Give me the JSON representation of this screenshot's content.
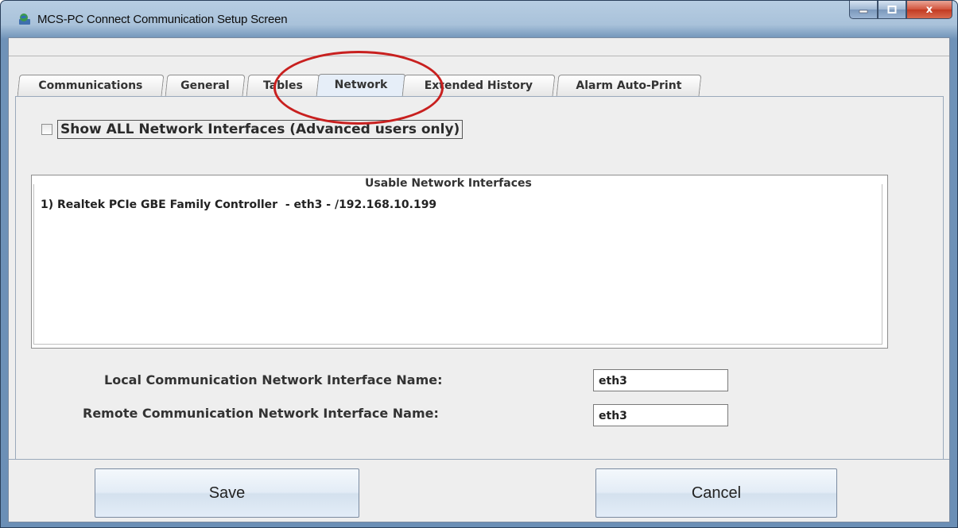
{
  "window": {
    "title": "MCS-PC Connect Communication Setup Screen",
    "app_icon": "globe-monitor-icon",
    "controls": {
      "minimize_icon": "minimize-icon",
      "maximize_icon": "maximize-icon",
      "close_icon": "close-icon",
      "close_glyph": "x"
    }
  },
  "tabs": [
    {
      "label": "Communications"
    },
    {
      "label": "General"
    },
    {
      "label": "Tables"
    },
    {
      "label": "Network",
      "active": true
    },
    {
      "label": "Extended History"
    },
    {
      "label": "Alarm Auto-Print"
    }
  ],
  "network": {
    "show_all_label": "Show ALL Network Interfaces (Advanced users only)",
    "show_all_checked": false,
    "usable_title": "Usable Network Interfaces",
    "interfaces": [
      "1) Realtek PCIe GBE Family Controller  - eth3 - /192.168.10.199"
    ],
    "local_label": "Local Communication Network Interface Name:",
    "local_value": "eth3",
    "remote_label": "Remote Communication Network Interface Name:",
    "remote_value": "eth3"
  },
  "buttons": {
    "save": "Save",
    "cancel": "Cancel"
  },
  "colors": {
    "annotation": "#c8201f",
    "title_bar": "#a9c2da",
    "panel": "#eeeeee"
  }
}
